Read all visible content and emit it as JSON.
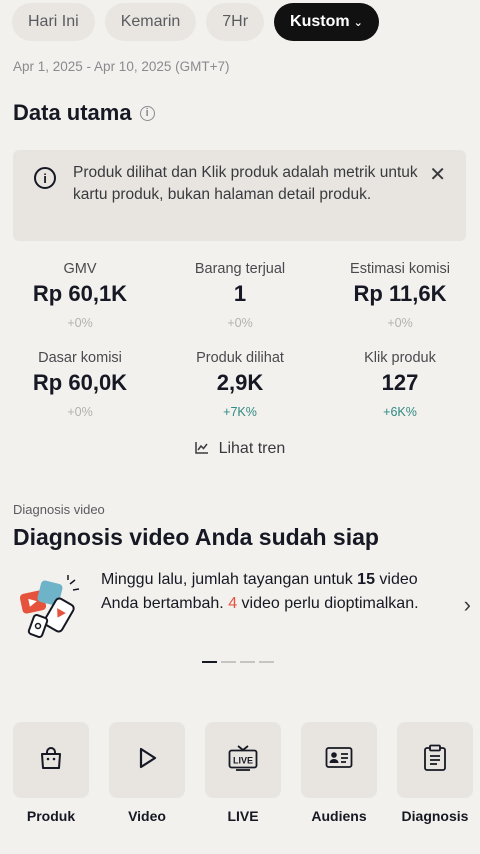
{
  "tabs": [
    {
      "label": "Hari Ini"
    },
    {
      "label": "Kemarin"
    },
    {
      "label": "7Hr"
    },
    {
      "label": "Kustom"
    }
  ],
  "date_range": "Apr 1, 2025 - Apr 10, 2025 (GMT+7)",
  "main_data": {
    "title": "Data utama",
    "notice": "Produk dilihat dan Klik produk adalah metrik untuk kartu produk, bukan halaman detail produk.",
    "metrics": [
      {
        "label": "GMV",
        "value": "Rp 60,1K",
        "change": "+0%"
      },
      {
        "label": "Barang terjual",
        "value": "1",
        "change": "+0%"
      },
      {
        "label": "Estimasi komisi",
        "value": "Rp 11,6K",
        "change": "+0%"
      },
      {
        "label": "Dasar komisi",
        "value": "Rp 60,0K",
        "change": "+0%"
      },
      {
        "label": "Produk dilihat",
        "value": "2,9K",
        "change": "+7K%"
      },
      {
        "label": "Klik produk",
        "value": "127",
        "change": "+6K%"
      }
    ],
    "trend_link": "Lihat tren"
  },
  "diagnosis": {
    "section_label": "Diagnosis video",
    "title": "Diagnosis video Anda sudah siap",
    "text_part1": "Minggu lalu, jumlah tayangan untuk ",
    "count_videos": "15",
    "text_part2": " video Anda bertambah. ",
    "count_optimize": "4",
    "text_part3": " video perlu dioptimalkan."
  },
  "bottom_nav": [
    {
      "label": "Produk",
      "icon": "shopping-bag-icon"
    },
    {
      "label": "Video",
      "icon": "play-icon"
    },
    {
      "label": "LIVE",
      "icon": "live-tv-icon"
    },
    {
      "label": "Audiens",
      "icon": "audience-card-icon"
    },
    {
      "label": "Diagnosis",
      "icon": "clipboard-icon"
    }
  ],
  "colors": {
    "highlight": "#e5533d",
    "positive_change": "#2f8a83",
    "active_tab_bg": "#111111",
    "background": "#f3f1ee"
  }
}
